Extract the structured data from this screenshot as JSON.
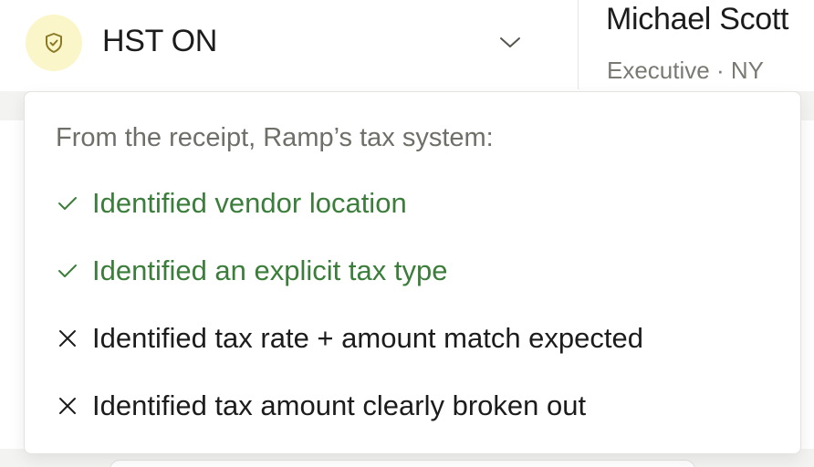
{
  "tax_selector": {
    "label": "HST ON",
    "icon": "shield-check-icon",
    "icon_bg": "#fbf6c9",
    "icon_color": "#8a7a26"
  },
  "user": {
    "name": "Michael Scott",
    "meta": "Executive · NY"
  },
  "tax_system_popover": {
    "heading": "From the receipt, Ramp’s tax system:",
    "items": [
      {
        "status": "pass",
        "icon": "check-icon",
        "label": "Identified vendor location"
      },
      {
        "status": "pass",
        "icon": "check-icon",
        "label": "Identified an explicit tax type"
      },
      {
        "status": "fail",
        "icon": "x-icon",
        "label": "Identified tax rate + amount match expected"
      },
      {
        "status": "fail",
        "icon": "x-icon",
        "label": "Identified tax amount clearly broken out"
      }
    ],
    "colors": {
      "pass": "#3b7d3a",
      "fail": "#1c1c1c"
    }
  }
}
